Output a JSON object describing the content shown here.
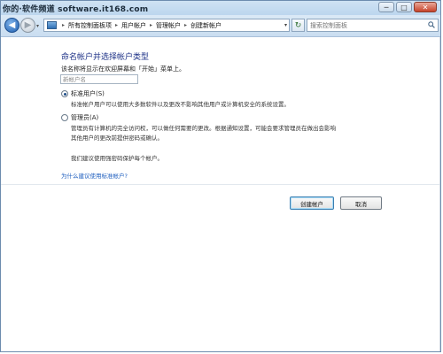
{
  "watermark": "你的·软件频道 software.it168.com",
  "titlebar": {
    "minimize_label": "─",
    "maximize_label": "□",
    "close_label": "✕"
  },
  "nav": {
    "back_label": "◀",
    "forward_label": "▶",
    "recent_label": "▾",
    "refresh_label": "↻"
  },
  "breadcrumb": [
    "所有控制面板项",
    "用户帐户",
    "管理帐户",
    "创建新帐户"
  ],
  "search": {
    "placeholder": "搜索控制面板"
  },
  "page": {
    "heading": "命名帐户并选择帐户类型",
    "instruction": "该名称将显示在欢迎屏幕和「开始」菜单上。",
    "name_placeholder": "新帐户名",
    "options": [
      {
        "label": "标准用户(S)",
        "checked": true,
        "description": [
          "标准帐户用户可以使用大多数软件以及更改不影响其他用户或计算机安全的系统设置。"
        ]
      },
      {
        "label": "管理员(A)",
        "checked": false,
        "description": [
          "管理员有计算机的完全访问权，可以做任何需要的更改。根据通知设置，可能会要求管理员在做出会影响",
          "其他用户的更改前提供密码或确认。"
        ]
      }
    ],
    "note": "我们建议使用强密码保护每个帐户。",
    "help_link": "为什么建议使用标准帐户?",
    "create_button": "创建帐户",
    "cancel_button": "取消"
  },
  "colors": {
    "heading": "#1e3287",
    "link": "#1f5fbf",
    "chrome": "#c9ddf0"
  },
  "icons": [
    "back-arrow-icon",
    "forward-arrow-icon",
    "control-panel-icon",
    "refresh-icon",
    "search-icon"
  ]
}
